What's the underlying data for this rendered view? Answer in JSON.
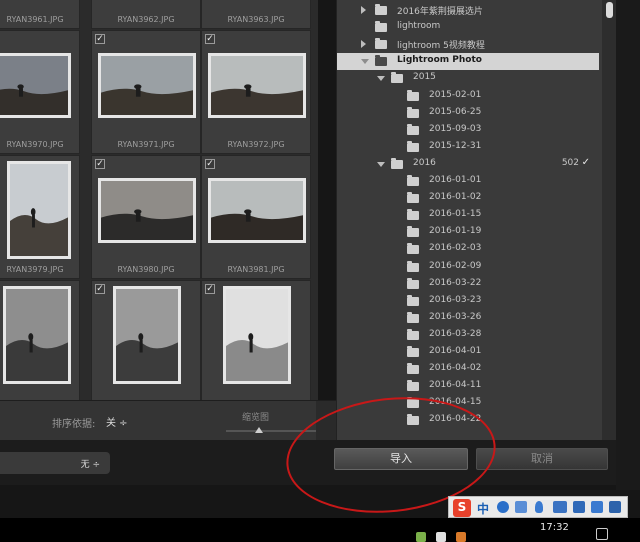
{
  "thumbnails": [
    {
      "name": "RYAN3961.JPG",
      "checked": false
    },
    {
      "name": "RYAN3962.JPG",
      "checked": false
    },
    {
      "name": "RYAN3963.JPG",
      "checked": false
    },
    {
      "name": "RYAN3970.JPG",
      "checked": false
    },
    {
      "name": "RYAN3971.JPG",
      "checked": true
    },
    {
      "name": "RYAN3972.JPG",
      "checked": true
    },
    {
      "name": "RYAN3979.JPG",
      "checked": false
    },
    {
      "name": "RYAN3980.JPG",
      "checked": true
    },
    {
      "name": "RYAN3981.JPG",
      "checked": true
    },
    {
      "name": "",
      "checked": false
    },
    {
      "name": "",
      "checked": true
    },
    {
      "name": "",
      "checked": true
    }
  ],
  "checkmark": "✓",
  "sortbar": {
    "sort_label": "排序依据:",
    "sort_value": "关 ÷",
    "thumb_label": "缩览图"
  },
  "bottom_dropdown": "无 ÷",
  "folders": [
    {
      "label": "2016年紫荆摄展选片",
      "level": 1,
      "expand": "right",
      "selected": false
    },
    {
      "label": "lightroom",
      "level": 1,
      "expand": "none",
      "selected": false
    },
    {
      "label": "lightroom 5视频教程",
      "level": 1,
      "expand": "right",
      "selected": false
    },
    {
      "label": "Lightroom Photo",
      "level": 1,
      "expand": "down",
      "selected": true
    },
    {
      "label": "2015",
      "level": 2,
      "expand": "down",
      "selected": false
    },
    {
      "label": "2015-02-01",
      "level": 3,
      "expand": "none",
      "selected": false
    },
    {
      "label": "2015-06-25",
      "level": 3,
      "expand": "none",
      "selected": false
    },
    {
      "label": "2015-09-03",
      "level": 3,
      "expand": "none",
      "selected": false
    },
    {
      "label": "2015-12-31",
      "level": 3,
      "expand": "none",
      "selected": false
    },
    {
      "label": "2016",
      "level": 2,
      "expand": "down",
      "selected": false,
      "count": "502",
      "check": "✓"
    },
    {
      "label": "2016-01-01",
      "level": 3,
      "expand": "none",
      "selected": false
    },
    {
      "label": "2016-01-02",
      "level": 3,
      "expand": "none",
      "selected": false
    },
    {
      "label": "2016-01-15",
      "level": 3,
      "expand": "none",
      "selected": false
    },
    {
      "label": "2016-01-19",
      "level": 3,
      "expand": "none",
      "selected": false
    },
    {
      "label": "2016-02-03",
      "level": 3,
      "expand": "none",
      "selected": false
    },
    {
      "label": "2016-02-09",
      "level": 3,
      "expand": "none",
      "selected": false
    },
    {
      "label": "2016-03-22",
      "level": 3,
      "expand": "none",
      "selected": false
    },
    {
      "label": "2016-03-23",
      "level": 3,
      "expand": "none",
      "selected": false
    },
    {
      "label": "2016-03-26",
      "level": 3,
      "expand": "none",
      "selected": false
    },
    {
      "label": "2016-03-28",
      "level": 3,
      "expand": "none",
      "selected": false
    },
    {
      "label": "2016-04-01",
      "level": 3,
      "expand": "none",
      "selected": false
    },
    {
      "label": "2016-04-02",
      "level": 3,
      "expand": "none",
      "selected": false
    },
    {
      "label": "2016-04-11",
      "level": 3,
      "expand": "none",
      "selected": false
    },
    {
      "label": "2016-04-15",
      "level": 3,
      "expand": "none",
      "selected": false
    },
    {
      "label": "2016-04-22",
      "level": 3,
      "expand": "none",
      "selected": false
    }
  ],
  "buttons": {
    "import": "导入",
    "cancel": "取消"
  },
  "ime": {
    "logo": "S",
    "mode": "中"
  },
  "clock": "17:32",
  "colors": {
    "annotation_circle": "#c81818",
    "selected_row": "#d4d4d4"
  }
}
